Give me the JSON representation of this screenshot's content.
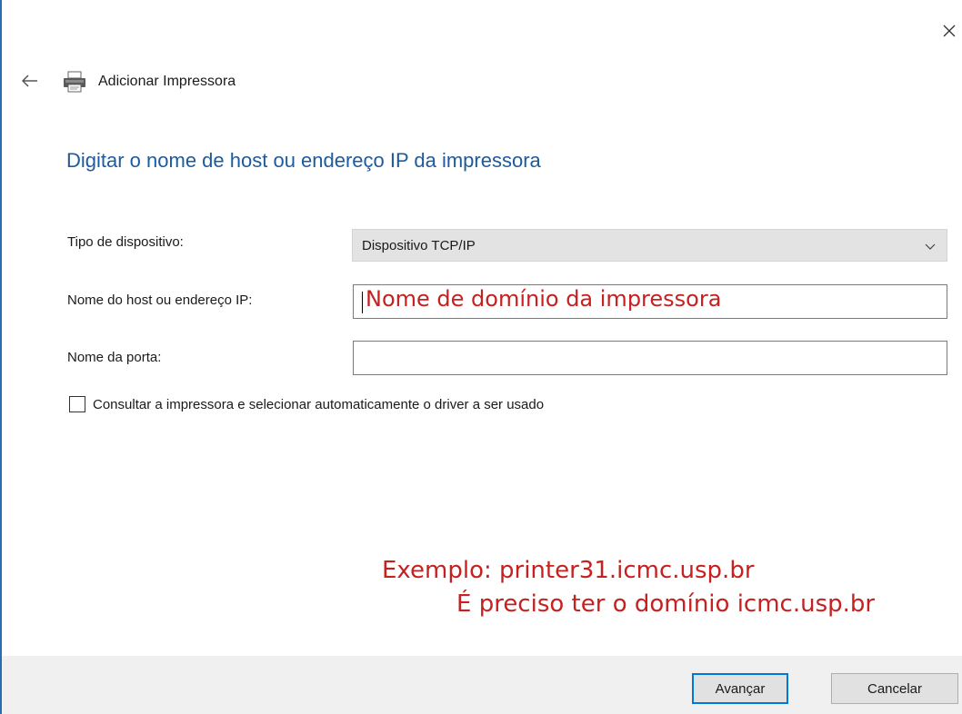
{
  "window": {
    "title": "Adicionar Impressora",
    "close_icon": "close-icon",
    "back_icon": "back-arrow-icon",
    "printer_icon": "printer-icon"
  },
  "page": {
    "heading": "Digitar o nome de host ou endereço IP da impressora"
  },
  "form": {
    "device_type": {
      "label": "Tipo de dispositivo:",
      "value": "Dispositivo TCP/IP"
    },
    "hostname": {
      "label": "Nome do host ou endereço IP:",
      "value": "",
      "annotation": "Nome de domínio da impressora"
    },
    "port": {
      "label": "Nome da porta:",
      "value": ""
    },
    "query_printer": {
      "label": "Consultar a impressora e selecionar automaticamente o driver a ser usado",
      "checked": false
    }
  },
  "annotations": {
    "example": "Exemplo: printer31.icmc.usp.br",
    "requirement": "É preciso ter o domínio icmc.usp.br"
  },
  "buttons": {
    "next": "Avançar",
    "cancel": "Cancelar"
  },
  "colors": {
    "heading": "#1c5b9e",
    "annotation": "#c62020",
    "primary_button_border": "#0078d7"
  }
}
